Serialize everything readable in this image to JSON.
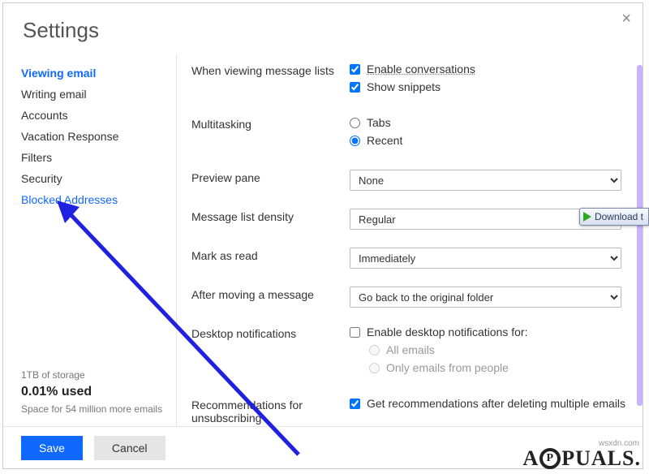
{
  "title": "Settings",
  "close_label": "×",
  "sidebar": {
    "items": [
      {
        "label": "Viewing email",
        "active": true
      },
      {
        "label": "Writing email"
      },
      {
        "label": "Accounts"
      },
      {
        "label": "Vacation Response"
      },
      {
        "label": "Filters"
      },
      {
        "label": "Security"
      },
      {
        "label": "Blocked Addresses",
        "highlight": true
      }
    ]
  },
  "storage": {
    "total": "1TB of storage",
    "used": "0.01% used",
    "remaining": "Space for 54 million more emails"
  },
  "settings": {
    "viewing_label": "When viewing message lists",
    "enable_conversations": "Enable conversations",
    "show_snippets": "Show snippets",
    "multitasking_label": "Multitasking",
    "multi_tabs": "Tabs",
    "multi_recent": "Recent",
    "preview_label": "Preview pane",
    "preview_value": "None",
    "density_label": "Message list density",
    "density_value": "Regular",
    "markread_label": "Mark as read",
    "markread_value": "Immediately",
    "aftermove_label": "After moving a message",
    "aftermove_value": "Go back to the original folder",
    "desktop_label": "Desktop notifications",
    "desktop_enable": "Enable desktop notifications for:",
    "desktop_all": "All emails",
    "desktop_people": "Only emails from people",
    "rec_label": "Recommendations for unsubscribing",
    "rec_text": "Get recommendations after deleting multiple emails"
  },
  "footer": {
    "save": "Save",
    "cancel": "Cancel"
  },
  "badge": {
    "text": "Download t"
  },
  "watermark": {
    "site": "wsxdn.com",
    "brand_pre": "A",
    "brand_mid": "P",
    "brand_post": "PUALS."
  }
}
